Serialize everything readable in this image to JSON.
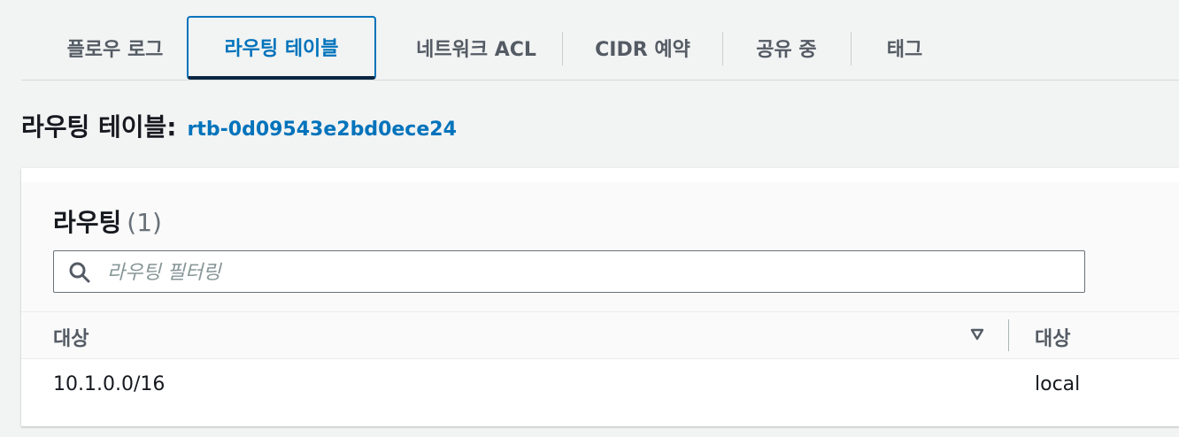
{
  "tabs": [
    {
      "label": "플로우 로그",
      "active": false
    },
    {
      "label": "라우팅 테이블",
      "active": true
    },
    {
      "label": "네트워크 ACL",
      "active": false
    },
    {
      "label": "CIDR 예약",
      "active": false
    },
    {
      "label": "공유 중",
      "active": false
    },
    {
      "label": "태그",
      "active": false
    }
  ],
  "heading": {
    "title": "라우팅 테이블:",
    "route_table_id": "rtb-0d09543e2bd0ece24"
  },
  "routes": {
    "title": "라우팅",
    "count": "(1)",
    "filter_placeholder": "라우팅 필터링",
    "filter_value": "",
    "columns": [
      "대상",
      "대상"
    ],
    "rows": [
      {
        "destination": "10.1.0.0/16",
        "target": "local"
      }
    ]
  },
  "colors": {
    "accent": "#0073bb",
    "text": "#16191f",
    "muted": "#545b64"
  },
  "icons": {
    "filter": "search-icon",
    "sort": "sort-caret-down-icon"
  }
}
